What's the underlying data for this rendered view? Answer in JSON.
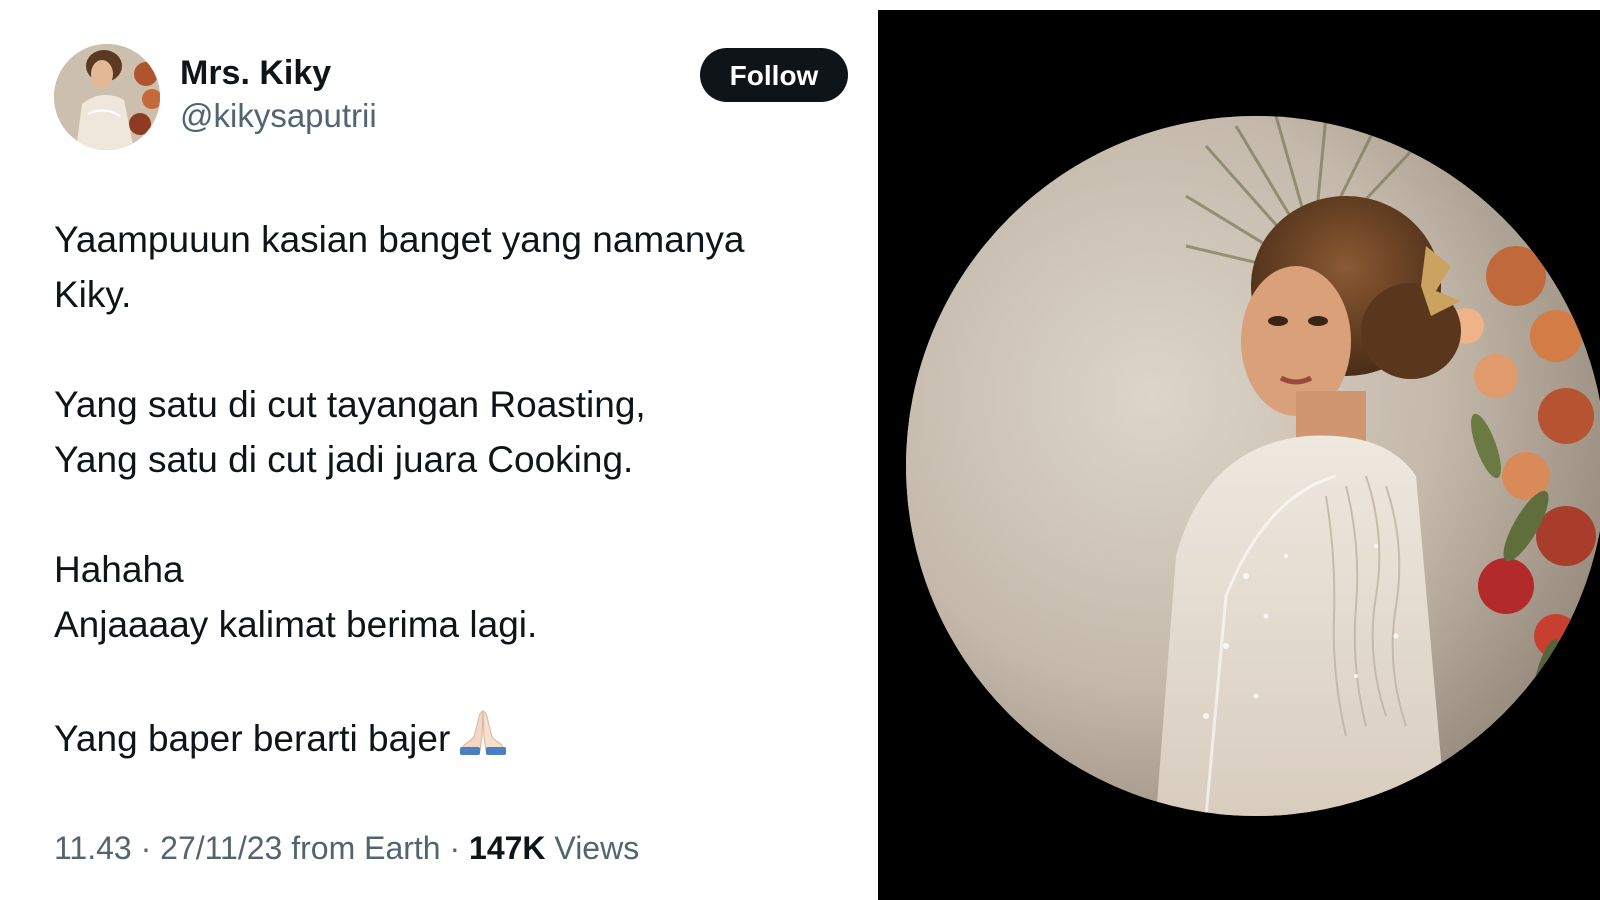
{
  "tweet": {
    "author": {
      "display_name": "Mrs. Kiky",
      "handle": "@kikysaputrii",
      "avatar_icon": "profile-photo"
    },
    "follow_label": "Follow",
    "text": {
      "p1_l1": "Yaampuuun kasian banget yang namanya",
      "p1_l2": "Kiky.",
      "p2_l1": "Yang satu di cut tayangan Roasting,",
      "p2_l2": "Yang satu di cut jadi juara Cooking.",
      "p3_l1": "Hahaha",
      "p3_l2": "Anjaaaay kalimat berima lagi.",
      "p4_l1": "Yang baper berarti bajer",
      "emoji": "folded-hands-icon"
    },
    "meta": {
      "time": "11.43",
      "separator": " · ",
      "date": "27/11/23",
      "location": " from Earth",
      "views_count": "147K",
      "views_label": " Views"
    }
  },
  "photo": {
    "icon": "profile-photo-enlarged",
    "background_color": "#000000"
  },
  "colors": {
    "text_primary": "#0f1419",
    "text_secondary": "#536471",
    "button_bg": "#0f1419",
    "button_text": "#ffffff"
  }
}
